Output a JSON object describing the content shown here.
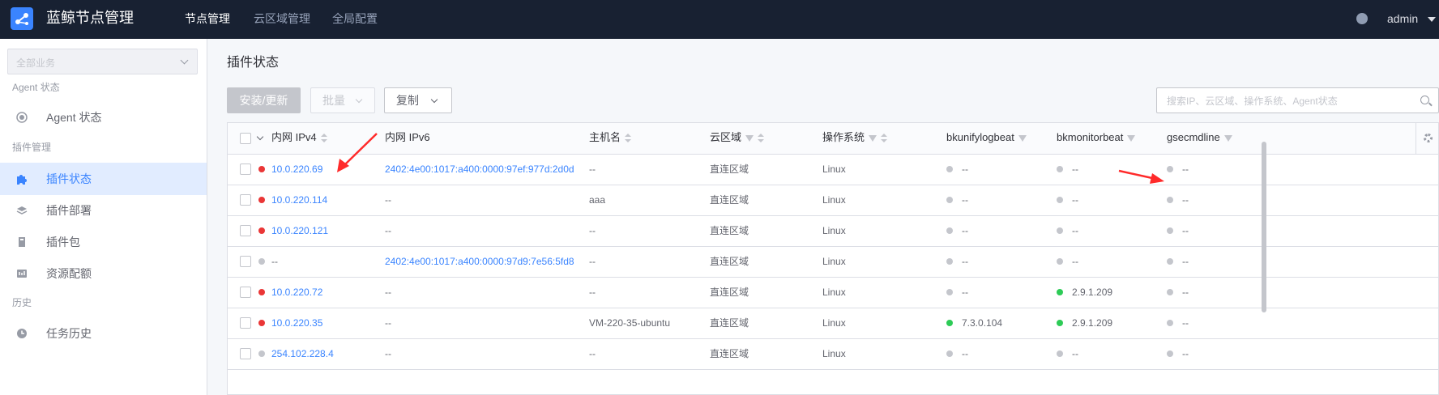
{
  "header": {
    "app_title": "蓝鲸节点管理",
    "nav": [
      "节点管理",
      "云区域管理",
      "全局配置"
    ],
    "user": "admin"
  },
  "sidebar": {
    "business_select": "全部业务",
    "groups": [
      "Agent 状态",
      "插件管理",
      "历史"
    ],
    "items": [
      {
        "label": "Agent 状态",
        "icon": "agent-status-icon"
      },
      {
        "label": "插件状态",
        "icon": "puzzle-icon",
        "active": true
      },
      {
        "label": "插件部署",
        "icon": "layers-icon"
      },
      {
        "label": "插件包",
        "icon": "package-icon"
      },
      {
        "label": "资源配额",
        "icon": "quota-icon"
      },
      {
        "label": "任务历史",
        "icon": "clock-icon"
      }
    ]
  },
  "main": {
    "title": "插件状态",
    "buttons": {
      "install": "安装/更新",
      "batch": "批量",
      "copy": "复制"
    },
    "search_placeholder": "搜索IP、云区域、操作系统、Agent状态"
  },
  "table": {
    "columns": [
      "内网 IPv4",
      "内网 IPv6",
      "主机名",
      "云区域",
      "操作系统",
      "bkunifylogbeat",
      "bkmonitorbeat",
      "gsecmdline"
    ],
    "rows": [
      {
        "ipv4_status": "red",
        "ipv4": "10.0.220.69",
        "ipv6": "2402:4e00:1017:a400:0000:97ef:977d:2d0d",
        "hostname": "--",
        "cloud": "直连区域",
        "os": "Linux",
        "plugins": [
          [
            "gray",
            "--"
          ],
          [
            "gray",
            "--"
          ],
          [
            "gray",
            "--"
          ]
        ]
      },
      {
        "ipv4_status": "red",
        "ipv4": "10.0.220.114",
        "ipv6": "--",
        "hostname": "aaa",
        "cloud": "直连区域",
        "os": "Linux",
        "plugins": [
          [
            "gray",
            "--"
          ],
          [
            "gray",
            "--"
          ],
          [
            "gray",
            "--"
          ]
        ]
      },
      {
        "ipv4_status": "red",
        "ipv4": "10.0.220.121",
        "ipv6": "--",
        "hostname": "--",
        "cloud": "直连区域",
        "os": "Linux",
        "plugins": [
          [
            "gray",
            "--"
          ],
          [
            "gray",
            "--"
          ],
          [
            "gray",
            "--"
          ]
        ]
      },
      {
        "ipv4_status": "gray",
        "ipv4": "--",
        "ipv6": "2402:4e00:1017:a400:0000:97d9:7e56:5fd8",
        "hostname": "--",
        "cloud": "直连区域",
        "os": "Linux",
        "plugins": [
          [
            "gray",
            "--"
          ],
          [
            "gray",
            "--"
          ],
          [
            "gray",
            "--"
          ]
        ]
      },
      {
        "ipv4_status": "red",
        "ipv4": "10.0.220.72",
        "ipv6": "--",
        "hostname": "--",
        "cloud": "直连区域",
        "os": "Linux",
        "plugins": [
          [
            "gray",
            "--"
          ],
          [
            "green",
            "2.9.1.209"
          ],
          [
            "gray",
            "--"
          ]
        ]
      },
      {
        "ipv4_status": "red",
        "ipv4": "10.0.220.35",
        "ipv6": "--",
        "hostname": "VM-220-35-ubuntu",
        "cloud": "直连区域",
        "os": "Linux",
        "plugins": [
          [
            "green",
            "7.3.0.104"
          ],
          [
            "green",
            "2.9.1.209"
          ],
          [
            "gray",
            "--"
          ]
        ]
      },
      {
        "ipv4_status": "gray",
        "ipv4": "254.102.228.4",
        "ipv6": "--",
        "hostname": "--",
        "cloud": "直连区域",
        "os": "Linux",
        "plugins": [
          [
            "gray",
            "--"
          ],
          [
            "gray",
            "--"
          ],
          [
            "gray",
            "--"
          ]
        ]
      }
    ]
  },
  "colors": {
    "red": "#ea3636",
    "gray": "#c4c6cc",
    "green": "#2dcb56",
    "accent": "#3a84ff",
    "annotation": "#ff2a2a"
  }
}
